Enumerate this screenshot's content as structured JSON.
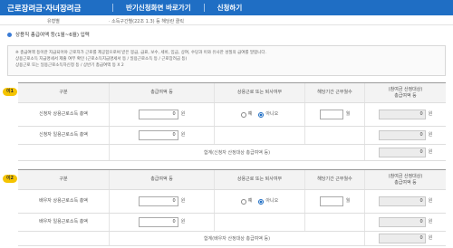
{
  "topbar": {
    "title": "근로장려금·자녀장려금",
    "actions": [
      "반기신청화면 바로가기",
      "신청하기"
    ]
  },
  "toprow": {
    "label": "유형별",
    "value": "· 소득구간별(22조 1.3) 등 해당란 클릭"
  },
  "section": {
    "title": "상용직 총급여액 등(1월~6월) 입력"
  },
  "notes": [
    "※ 총급여액 등이란 지급되어야 근로자가 근로를 제공함으로써 받은 봉급, 급료, 보수, 세비, 임금, 상여, 수당과 이와 유사한 성질의 급여를 말합니다.",
    "상용근로소득 지급명세서 제출 여부 확인 (근로소득지급명세서 등 / 일용근로소득 등 / 근로장려금 등)",
    "상용근로 또는 일용근로소득자신청 등 / 상반기 총급여액 등 X 2"
  ],
  "tables": [
    {
      "tag": "이1",
      "headers": [
        "구분",
        "총급여액 등",
        "상용근로 또는 퇴사여부",
        "해당기간 근무월수",
        "(참여금 산정대상)\n총급여액 등"
      ],
      "rows": [
        {
          "label": "신청자 상용근로소득 총액",
          "amount": "0",
          "unit": "원",
          "radio_yes": "예",
          "radio_no": "아니오",
          "months_unit": "월",
          "calc": "0",
          "calc_unit": "원"
        },
        {
          "label": "신청자 일용근로소득 총액",
          "amount": "0",
          "unit": "원",
          "radio_yes": "",
          "radio_no": "",
          "months_unit": "",
          "calc": "0",
          "calc_unit": "원"
        }
      ],
      "total_label": "합계(신청자 산정대상 총급여액 등)",
      "total_value": "0",
      "total_unit": "원"
    },
    {
      "tag": "이2",
      "headers": [
        "구분",
        "총급여액 등",
        "상용근로 또는 퇴사여부",
        "해당기간 근무월수",
        "(참여금 산정대상)\n총급여액 등"
      ],
      "rows": [
        {
          "label": "배우자 상용근로소득 총액",
          "amount": "0",
          "unit": "원",
          "radio_yes": "예",
          "radio_no": "아니오",
          "months_unit": "월",
          "calc": "0",
          "calc_unit": "원"
        },
        {
          "label": "배우자 일용근로소득 총액",
          "amount": "0",
          "unit": "원",
          "radio_yes": "",
          "radio_no": "",
          "months_unit": "",
          "calc": "0",
          "calc_unit": "원"
        }
      ],
      "total_label": "합계(배우자 산정대상 총급여액 등)",
      "total_value": "0",
      "total_unit": "원"
    }
  ]
}
